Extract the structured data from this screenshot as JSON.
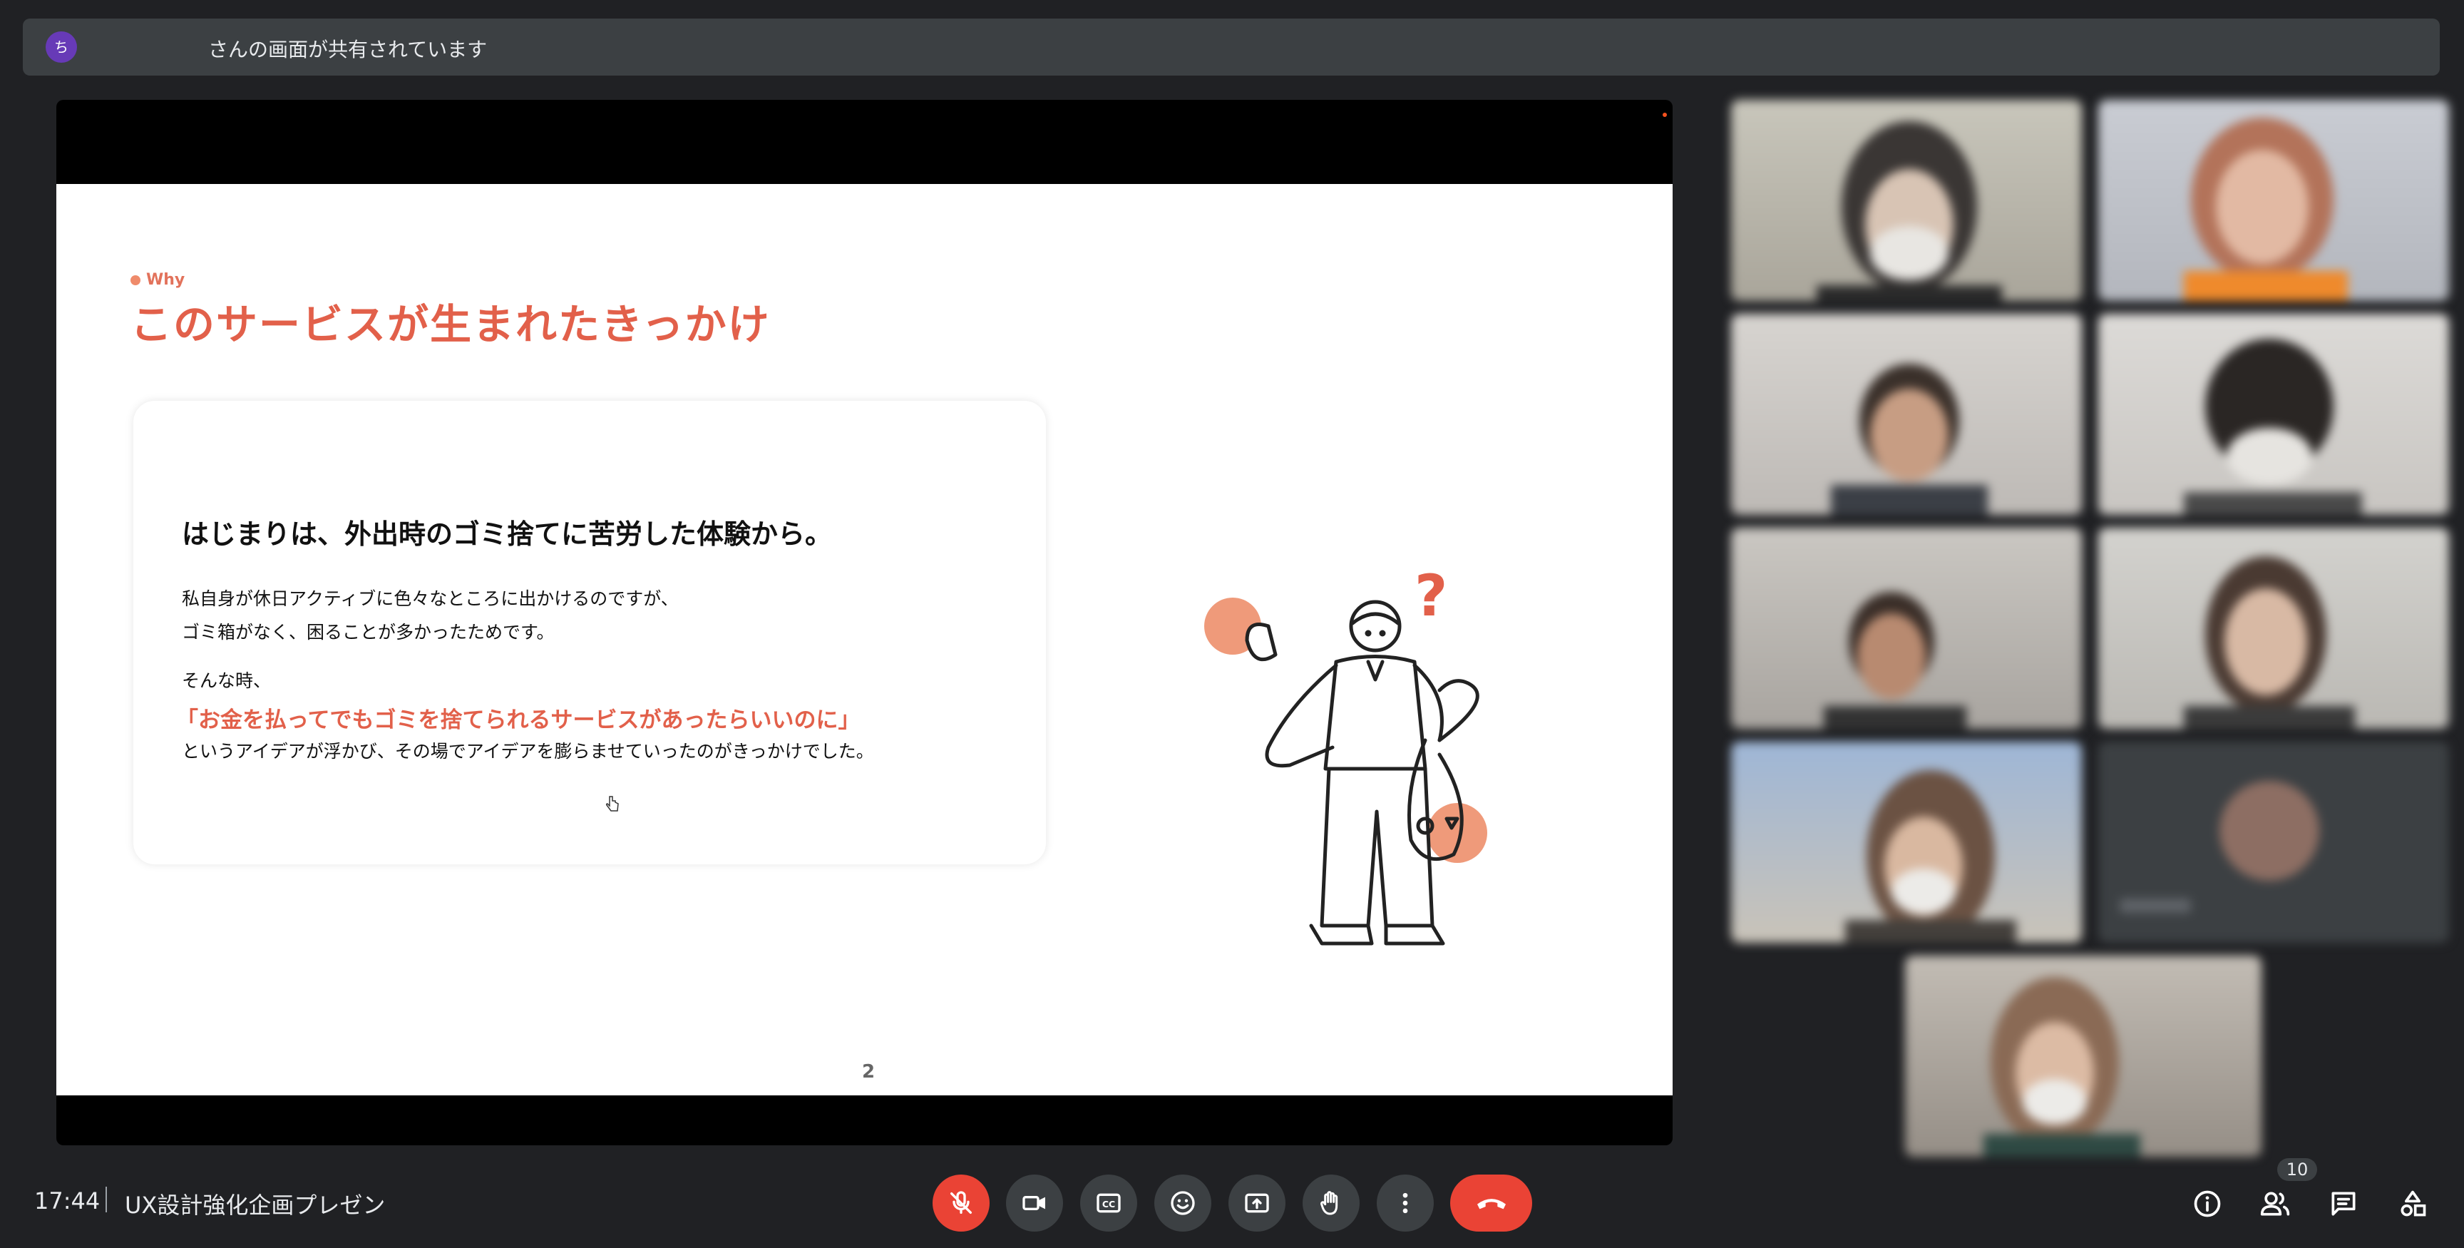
{
  "banner": {
    "avatar_initial": "ち",
    "text": "さんの画面が共有されています"
  },
  "slide": {
    "section_label": "Why",
    "title": "このサービスが生まれたきっかけ",
    "card": {
      "heading": "はじまりは、外出時のゴミ捨てに苦労した体験から。",
      "line1": "私自身が休日アクティブに色々なところに出かけるのですが、",
      "line2": "ゴミ箱がなく、困ることが多かったためです。",
      "line3": "そんな時、",
      "quote": "「お金を払ってでもゴミを捨てられるサービスがあったらいいのに」",
      "line4": "というアイデアが浮かび、その場でアイデアを膨らませていったのがきっかけでした。"
    },
    "page_number": "2"
  },
  "footer": {
    "time": "17:44",
    "meeting_title": "UX設計強化企画プレゼン",
    "participant_count": "10"
  },
  "controls": [
    "microphone-off",
    "camera",
    "captions",
    "emoji",
    "present",
    "raise-hand",
    "more-options",
    "leave-call"
  ],
  "right_controls": [
    "meeting-info",
    "people",
    "chat",
    "activities"
  ],
  "colors": {
    "accent": "#e2604a",
    "danger": "#ea4335",
    "background": "#202124",
    "control": "#3c4043"
  }
}
